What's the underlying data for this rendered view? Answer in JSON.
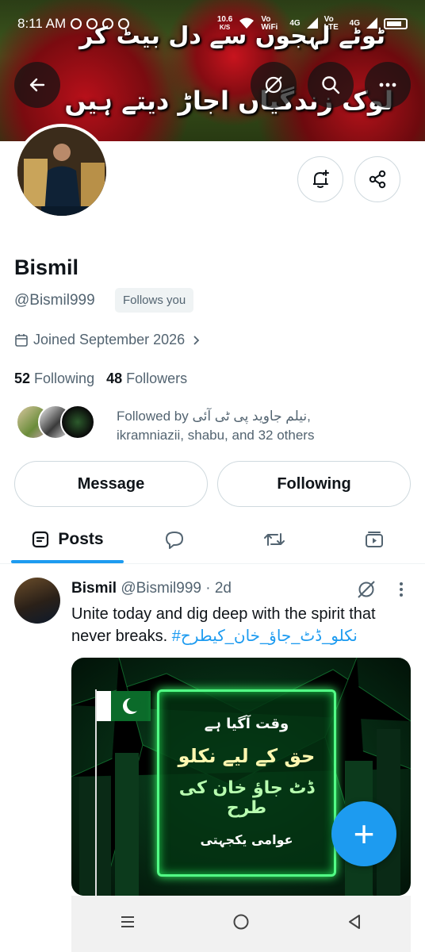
{
  "status_bar": {
    "time": "8:11 AM",
    "speed": "10.6",
    "speed_unit": "K/S",
    "net1": "Vo WiFi",
    "net2": "4G",
    "net3": "Vo LTE",
    "net4": "4G"
  },
  "banner": {
    "line1": "ٹوٹے لہجوں سے دل بیٹ کر",
    "line2": "لوک زندگیاں اجاڑ دیتے ہیں"
  },
  "header_buttons": {
    "back": "back-arrow-icon",
    "grok": "grok-icon",
    "search": "search-icon",
    "more": "more-icon"
  },
  "profile": {
    "name": "Bismil",
    "handle": "@Bismil999",
    "follows_you": "Follows you",
    "joined": "Joined September 2026",
    "following_count": "52",
    "following_label": "Following",
    "followers_count": "48",
    "followers_label": "Followers",
    "followed_by_line1": "Followed by نیلم جاوید پی ٹی آئی,",
    "followed_by_line2": "ikramniazii, shabu, and 32 others"
  },
  "actions": {
    "message": "Message",
    "following": "Following"
  },
  "tabs": [
    {
      "label": "Posts",
      "icon": "posts-icon",
      "active": true
    },
    {
      "label": "",
      "icon": "replies-icon"
    },
    {
      "label": "",
      "icon": "reposts-icon"
    },
    {
      "label": "",
      "icon": "media-icon"
    }
  ],
  "post": {
    "author": "Bismil",
    "handle": "@Bismil999",
    "time": "· 2d",
    "text": "Unite today and dig deep with the spirit that never breaks.",
    "hashtag": "#نکلو_ڈٹ_جاؤ_خان_کیطرح",
    "image_text": {
      "line1": "وقت آگیا ہے",
      "line2": "حق کے لیے نکلو",
      "line3": "ڈٹ جاؤ خان کی طرح",
      "line4": "عوامی یکجہتی"
    }
  },
  "fab": "+",
  "colors": {
    "accent": "#1d9bf0",
    "text_primary": "#0f1419",
    "text_secondary": "#536471",
    "border": "#cfd9de"
  }
}
